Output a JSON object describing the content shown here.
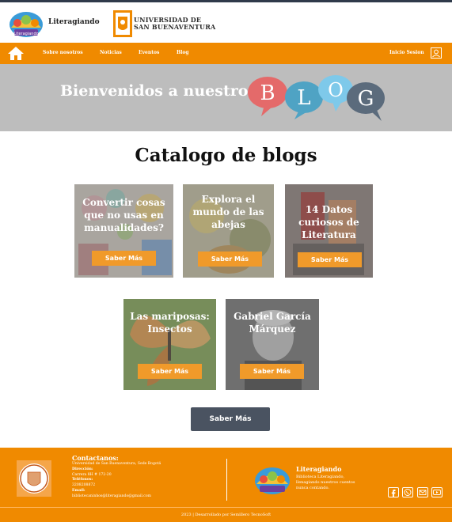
{
  "header": {
    "brand": "Literagiando",
    "university_line1": "UNIVERSIDAD DE",
    "university_line2": "SAN BUENAVENTURA"
  },
  "nav": {
    "items": [
      "Sobre nosotros",
      "Noticias",
      "Eventos",
      "Blog"
    ],
    "login": "Inicio Sesion"
  },
  "banner": {
    "title": "Bienvenidos a nuestro",
    "bubble_letters": [
      "B",
      "L",
      "O",
      "G"
    ]
  },
  "catalog": {
    "title": "Catalogo de blogs",
    "cards": [
      {
        "title": "Convertir cosas que no usas en manualidades?",
        "button": "Saber Más"
      },
      {
        "title": "Explora el mundo de las abejas",
        "button": "Saber Más"
      },
      {
        "title": "14 Datos curiosos de Literatura",
        "button": "Saber Más"
      },
      {
        "title": "Las mariposas: Insectos",
        "button": "Saber Más"
      },
      {
        "title": "Gabriel García Márquez",
        "button": "Saber Más"
      }
    ],
    "more_button": "Saber Más"
  },
  "footer": {
    "contact_heading": "Contactanos:",
    "address": "Universidad de San Buenaventura, Sede Bogotá",
    "direccion_label": "Dirección:",
    "direccion_value": "Carrera 8H # 172-20",
    "telefono_label": "Teléfonos:",
    "telefono_value": "3208208872",
    "email_label": "Email:",
    "email_value": "bibliotecaninhos@literagiando@gmail.com",
    "brand": "Literagiando",
    "description": "Biblioteca Literagiando, llenagiando nuestros cuentos nunca contando.",
    "social_icons": [
      "facebook-icon",
      "whatsapp-icon",
      "mail-icon",
      "youtube-icon"
    ],
    "copyright": "2023 | Desarrollado por Semillero TecnoSoft"
  },
  "colors": {
    "orange": "#f08a00",
    "button_orange": "#f09a2a",
    "banner_gray": "#bdbdbd",
    "dark_button": "#4a5361"
  }
}
